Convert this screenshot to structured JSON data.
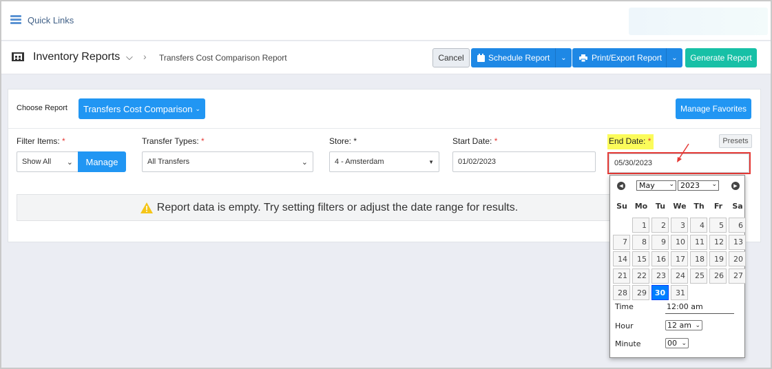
{
  "quick_links": {
    "label": "Quick Links"
  },
  "header": {
    "title": "Inventory Reports",
    "crumb": "Transfers Cost Comparison Report",
    "cancel": "Cancel",
    "schedule": "Schedule Report",
    "print": "Print/Export Report",
    "generate": "Generate Report"
  },
  "report": {
    "choose_label": "Choose Report",
    "selected": "Transfers Cost Comparison",
    "manage_favorites": "Manage Favorites"
  },
  "filters": {
    "filter_items_label": "Filter Items:",
    "filter_items_value": "Show All",
    "manage": "Manage",
    "transfer_types_label": "Transfer Types:",
    "transfer_types_value": "All Transfers",
    "store_label": "Store:",
    "store_value": "4 - Amsterdam",
    "start_label": "Start Date:",
    "start_value": "01/02/2023",
    "end_label": "End Date:",
    "end_value": "05/30/2023",
    "presets": "Presets",
    "required_mark": "*"
  },
  "empty_message": "Report data is empty. Try setting filters or adjust the date range for results.",
  "calendar": {
    "month": "May",
    "year": "2023",
    "weekdays": [
      "Su",
      "Mo",
      "Tu",
      "We",
      "Th",
      "Fr",
      "Sa"
    ],
    "selected_day": 30,
    "time_label": "Time",
    "time_value": "12:00 am",
    "hour_label": "Hour",
    "hour_value": "12 am",
    "minute_label": "Minute",
    "minute_value": "00"
  },
  "colors": {
    "primary": "#2196f3",
    "teal": "#17c0a6",
    "highlight": "#fbfb5a",
    "error": "#e53935"
  }
}
